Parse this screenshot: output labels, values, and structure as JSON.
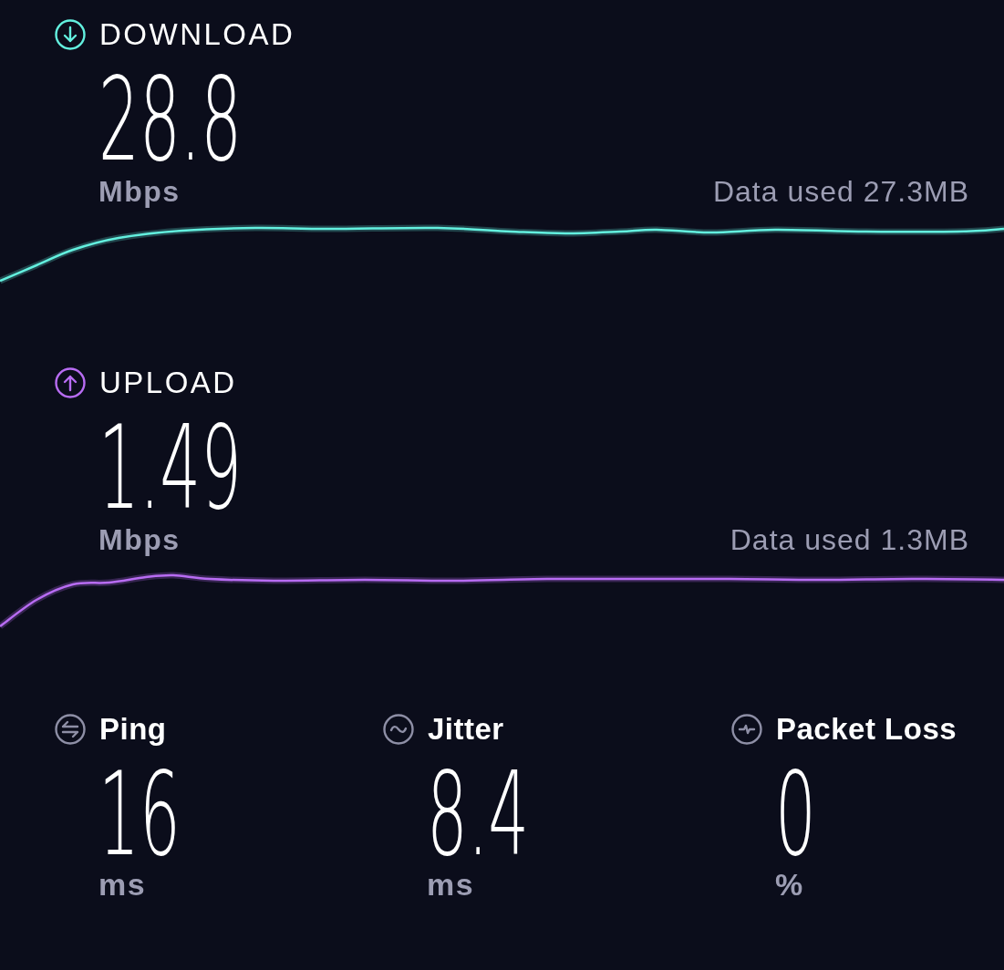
{
  "tests": [
    {
      "kind": "download",
      "label": "DOWNLOAD",
      "value": "28.8",
      "unit": "Mbps",
      "data_used": "Data used 27.3MB",
      "color": "#63f0df"
    },
    {
      "kind": "upload",
      "label": "UPLOAD",
      "value": "1.49",
      "unit": "Mbps",
      "data_used": "Data used 1.3MB",
      "color": "#b86cf3"
    }
  ],
  "stats": [
    {
      "kind": "ping",
      "label": "Ping",
      "value": "16",
      "unit": "ms"
    },
    {
      "kind": "jitter",
      "label": "Jitter",
      "value": "8.4",
      "unit": "ms"
    },
    {
      "kind": "packet_loss",
      "label": "Packet Loss",
      "value": "0",
      "unit": "%"
    }
  ]
}
